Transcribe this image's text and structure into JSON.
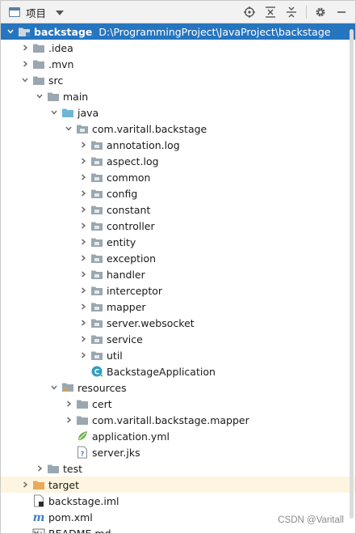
{
  "toolbar": {
    "title": "项目",
    "icons": [
      "project-panel-icon",
      "dropdown-icon",
      "locate-icon",
      "expand-all-icon",
      "collapse-all-icon",
      "gear-icon",
      "minimize-icon"
    ]
  },
  "tree": {
    "root": {
      "label": "backstage",
      "path": "D:\\ProgrammingProject\\JavaProject\\backstage"
    },
    "idea": ".idea",
    "mvn": ".mvn",
    "src": "src",
    "main": "main",
    "java": "java",
    "pkg": "com.varitall.backstage",
    "packages": [
      "annotation.log",
      "aspect.log",
      "common",
      "config",
      "constant",
      "controller",
      "entity",
      "exception",
      "handler",
      "interceptor",
      "mapper",
      "server.websocket",
      "service",
      "util"
    ],
    "app_class": "BackstageApplication",
    "resources": "resources",
    "cert": "cert",
    "mapper_pkg": "com.varitall.backstage.mapper",
    "app_yml": "application.yml",
    "server_jks": "server.jks",
    "test": "test",
    "target": "target",
    "iml": "backstage.iml",
    "pom": "pom.xml",
    "readme": "README.md"
  },
  "colors": {
    "selection": "#2675bf",
    "folder": "#9aa7b0",
    "source_folder": "#6eb5d9",
    "target_folder": "#e8a95b",
    "resources_folder": "#a8b36b"
  },
  "watermark": "CSDN @Varitall"
}
